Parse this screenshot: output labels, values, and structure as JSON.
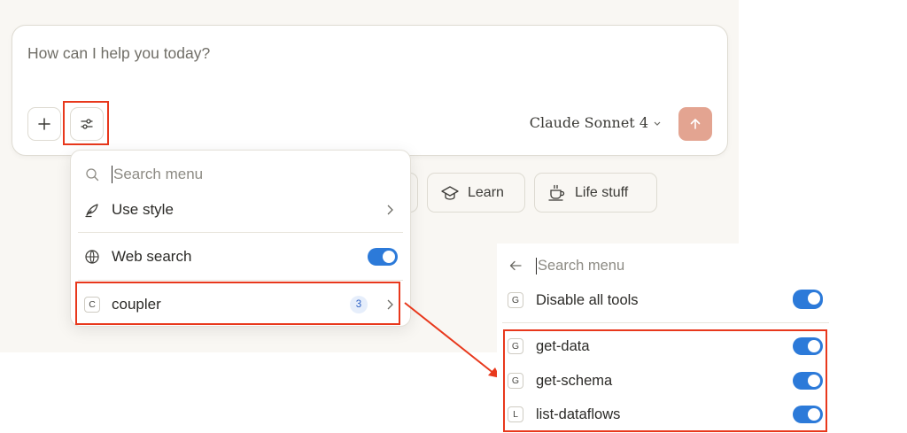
{
  "composer": {
    "placeholder": "How can I help you today?",
    "model_brand": "Claude",
    "model_name": "Sonnet 4",
    "plus_icon": "plus-icon",
    "tools_icon": "sliders-icon",
    "send_icon": "arrow-up-icon"
  },
  "chips": [
    {
      "label": "Learn",
      "icon": "graduation-cap-icon"
    },
    {
      "label": "Life stuff",
      "icon": "coffee-cup-icon"
    }
  ],
  "menu": {
    "search_placeholder": "Search menu",
    "items": [
      {
        "label": "Use style",
        "icon": "feather-pen-icon"
      },
      {
        "label": "Web search",
        "icon": "globe-icon",
        "enabled": true
      },
      {
        "label": "coupler",
        "letter": "C",
        "badge": "3"
      }
    ]
  },
  "submenu": {
    "search_placeholder": "Search menu",
    "disable_all": {
      "label": "Disable all tools",
      "letter": "G",
      "enabled": true
    },
    "tools": [
      {
        "label": "get-data",
        "letter": "G",
        "enabled": true
      },
      {
        "label": "get-schema",
        "letter": "G",
        "enabled": true
      },
      {
        "label": "list-dataflows",
        "letter": "L",
        "enabled": true
      }
    ]
  },
  "colors": {
    "highlight": "#e8381c",
    "toggle_on": "#2c7ad9",
    "send_button": "#e3a491",
    "background": "#f9f7f3"
  }
}
